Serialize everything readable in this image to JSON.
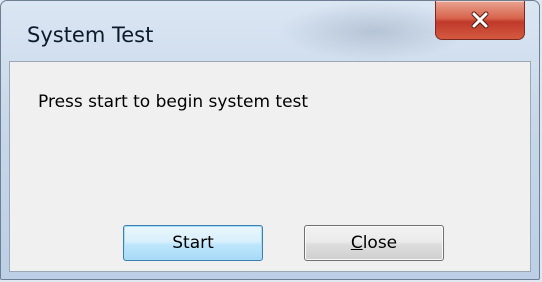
{
  "window": {
    "title": "System Test",
    "close_icon": "close-x-icon"
  },
  "dialog": {
    "message": "Press start to begin system test",
    "buttons": {
      "start_label": "Start",
      "close_mnemonic": "C",
      "close_rest": "lose"
    }
  },
  "colors": {
    "close_button": "#c0392b",
    "default_button_border": "#3c7fb1"
  }
}
